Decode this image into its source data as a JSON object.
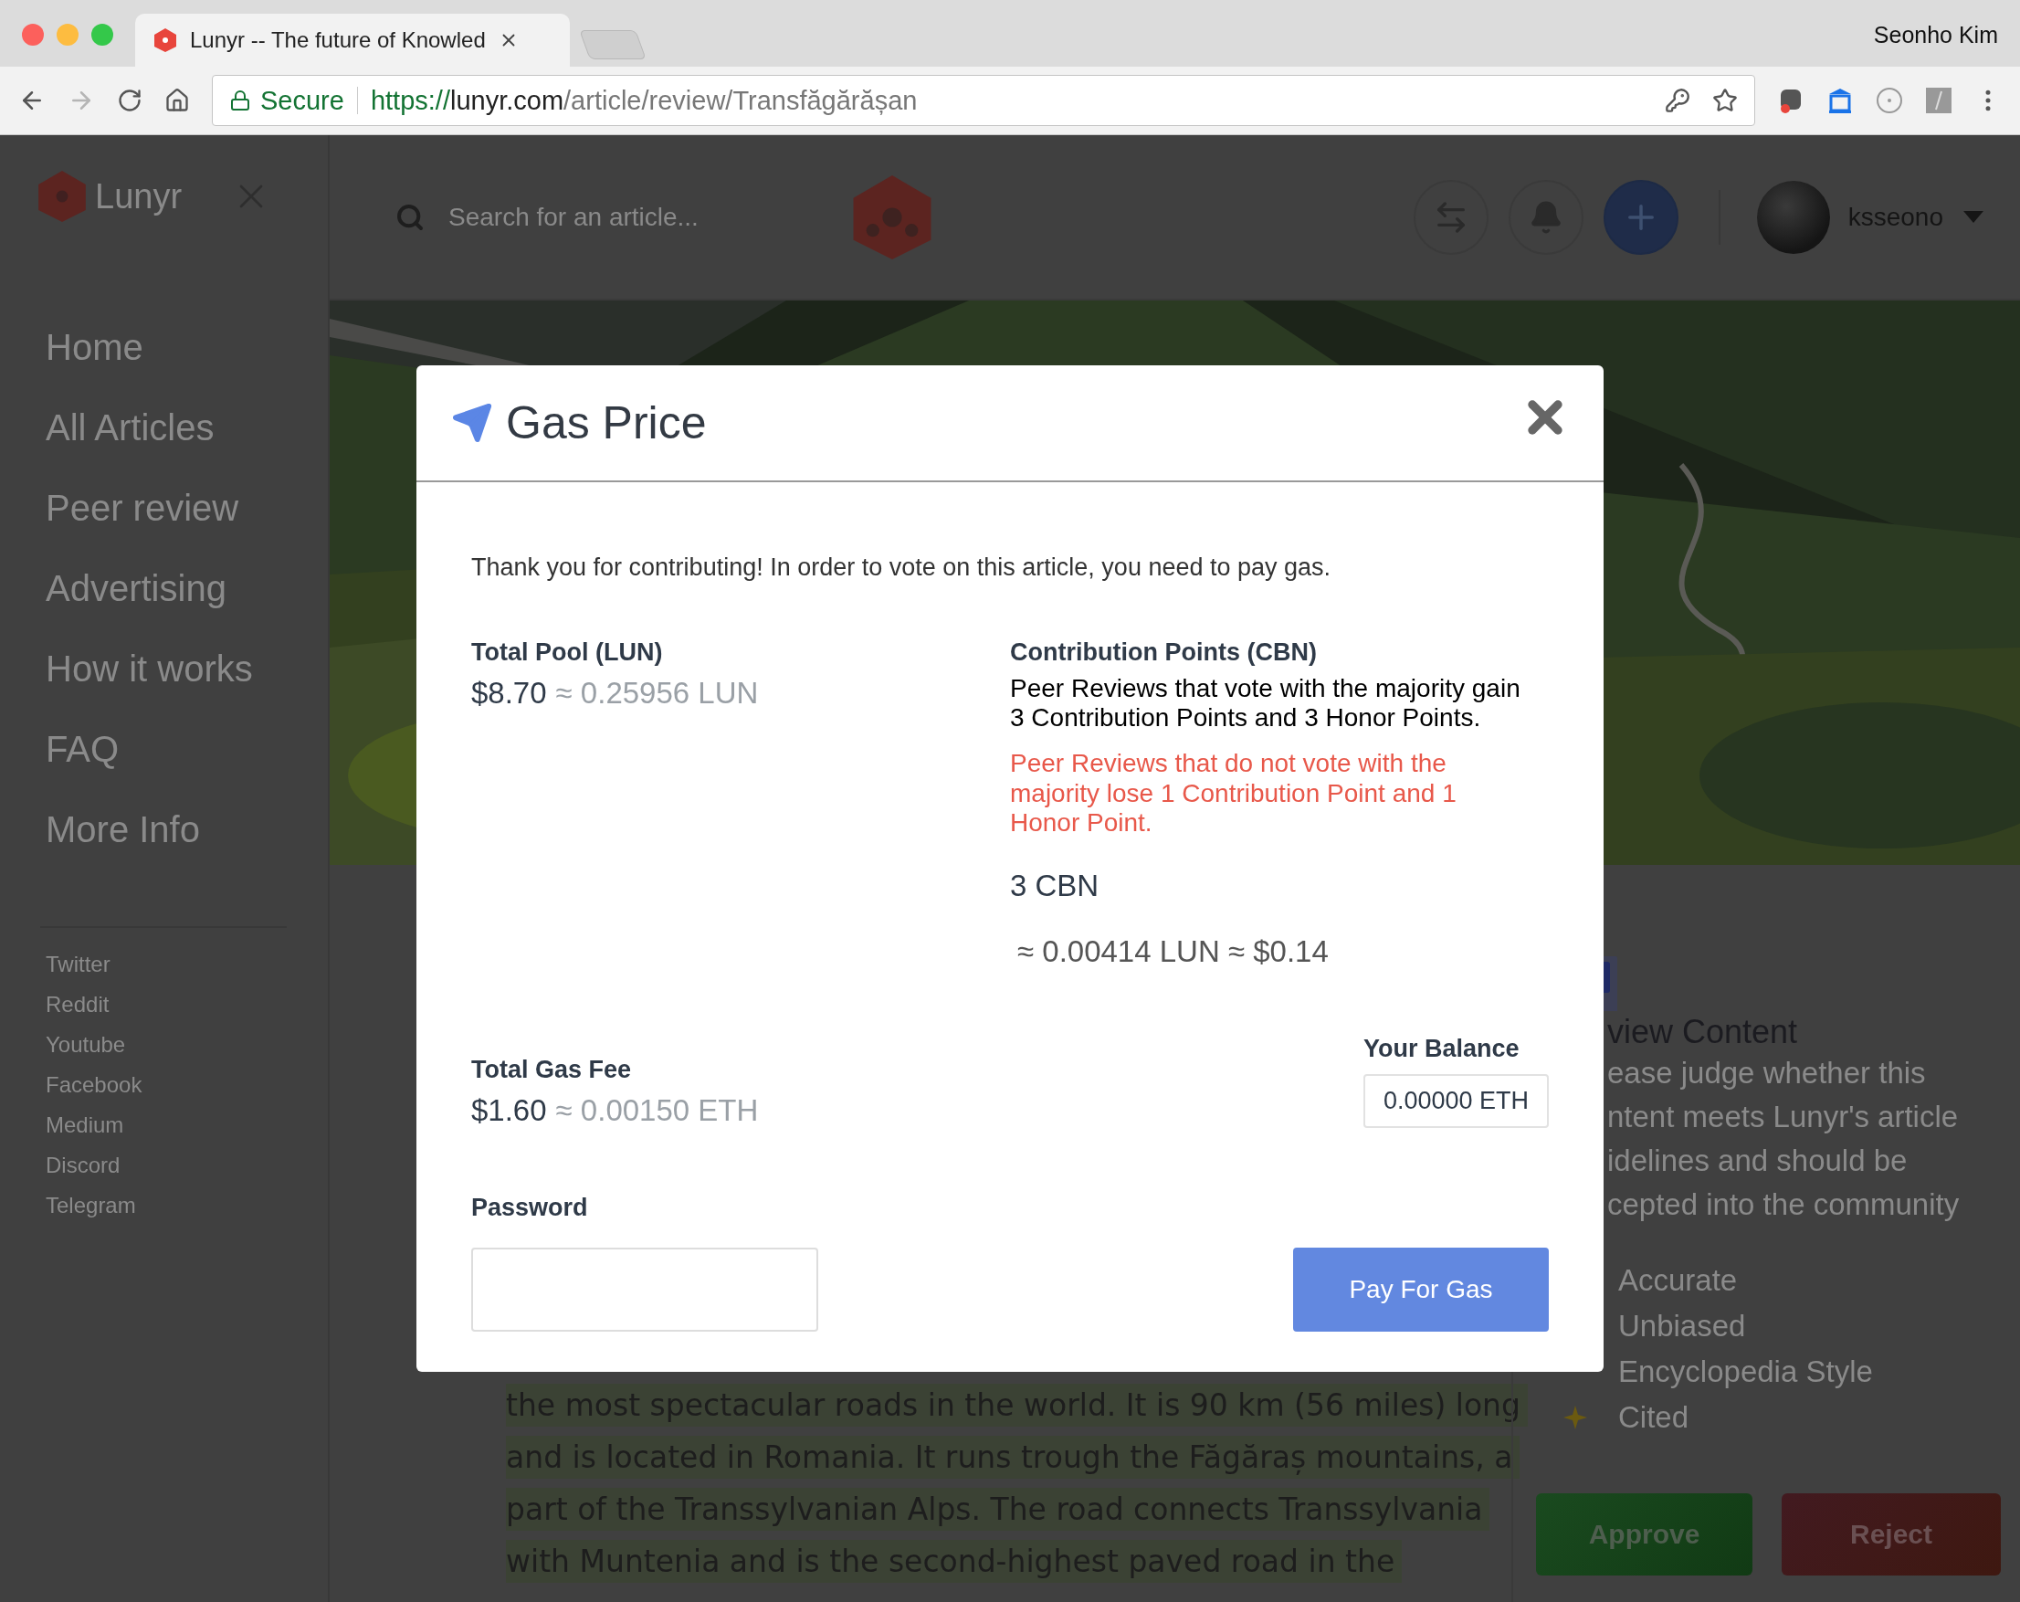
{
  "browser": {
    "tab_title": "Lunyr -- The future of Knowled",
    "user_name": "Seonho Kim",
    "secure_label": "Secure",
    "url": {
      "scheme": "https://",
      "host": "lunyr.com",
      "path": "/article/review/Transfăgărășan"
    }
  },
  "sidebar": {
    "brand": "Lunyr",
    "nav": [
      "Home",
      "All Articles",
      "Peer review",
      "Advertising",
      "How it works",
      "FAQ",
      "More Info"
    ],
    "links": [
      "Twitter",
      "Reddit",
      "Youtube",
      "Facebook",
      "Medium",
      "Discord",
      "Telegram"
    ]
  },
  "header": {
    "search_placeholder": "Search for an article...",
    "username": "ksseono"
  },
  "article": {
    "lines": [
      "the most spectacular roads in the world. It is 90 km (56 miles) long",
      "and is located in Romania. It runs trough the Făgăraș mountains, a",
      "part of the Transsylvanian Alps. The road connects Transsylvania",
      "with Muntenia and is the second-highest paved road in the"
    ]
  },
  "review_panel": {
    "heading": "view Content",
    "description_lines": [
      "ease judge whether this",
      "ntent meets Lunyr's article",
      "idelines and should be",
      "cepted into the community"
    ],
    "criteria": [
      "Accurate",
      "Unbiased",
      "Encyclopedia Style",
      "Cited"
    ],
    "buttons": [
      {
        "label": "Approve",
        "kind": "approve"
      },
      {
        "label": "Reject",
        "kind": "reject"
      }
    ]
  },
  "modal": {
    "title": "Gas Price",
    "intro": "Thank you for contributing! In order to vote on this article, you need to pay gas.",
    "total_pool": {
      "label": "Total Pool (LUN)",
      "usd": "$8.70",
      "approx": "≈ 0.25956 LUN"
    },
    "contribution": {
      "label": "Contribution Points (CBN)",
      "gain_text": "Peer Reviews that vote with the majority gain 3 Contribution Points and 3 Honor Points.",
      "loss_text": "Peer Reviews that do not vote with the majority lose 1 Contribution Point and 1 Honor Point.",
      "amount": "3 CBN",
      "approx": "≈ 0.00414 LUN ≈ $0.14"
    },
    "gas_fee": {
      "label": "Total Gas Fee",
      "usd": "$1.60",
      "approx": "≈ 0.00150 ETH"
    },
    "balance": {
      "label": "Your Balance",
      "value": "0.00000 ETH"
    },
    "password": {
      "label": "Password"
    },
    "pay_button": "Pay For Gas"
  }
}
